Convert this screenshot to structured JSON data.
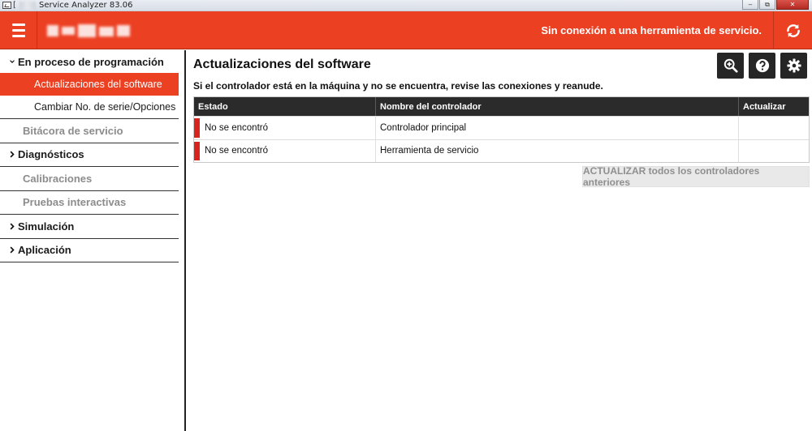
{
  "window": {
    "title_letter": "[",
    "title": "Service Analyzer 83.06",
    "controls": [
      "minimize-icon",
      "restore-icon",
      "close-icon"
    ]
  },
  "header": {
    "menu_icon": "hamburger-icon",
    "connection_status": "Sin conexión a una herramienta de servicio.",
    "refresh_icon": "refresh-icon",
    "accent_color": "#ec4023"
  },
  "sidebar": {
    "programming": {
      "label": "En proceso de programación",
      "expanded": true,
      "items": [
        {
          "label": "Actualizaciones del software",
          "active": true
        },
        {
          "label": "Cambiar No. de serie/Opciones",
          "active": false
        }
      ]
    },
    "service_log": {
      "label": "Bitácora de servicio",
      "enabled": false
    },
    "diagnostics": {
      "label": "Diagnósticos",
      "expanded": false
    },
    "calibrations": {
      "label": "Calibraciones",
      "enabled": false
    },
    "interactive_tests": {
      "label": "Pruebas interactivas",
      "enabled": false
    },
    "simulation": {
      "label": "Simulación",
      "expanded": false
    },
    "application": {
      "label": "Aplicación",
      "expanded": false
    }
  },
  "main": {
    "title": "Actualizaciones del software",
    "subtitle": "Si el controlador está en la máquina y no se encuentra, revise las conexiones y reanude.",
    "toolbar_icons": [
      "zoom-in-icon",
      "help-icon",
      "settings-icon"
    ],
    "table": {
      "columns": [
        "Estado",
        "Nombre del controlador",
        "Actualizar"
      ],
      "rows": [
        {
          "status": "No se encontró",
          "controller": "Controlador principal",
          "update": ""
        },
        {
          "status": "No se encontró",
          "controller": "Herramienta de servicio",
          "update": ""
        }
      ],
      "status_color": "#d9241e"
    },
    "update_all_label": "ACTUALIZAR todos los controladores anteriores"
  }
}
